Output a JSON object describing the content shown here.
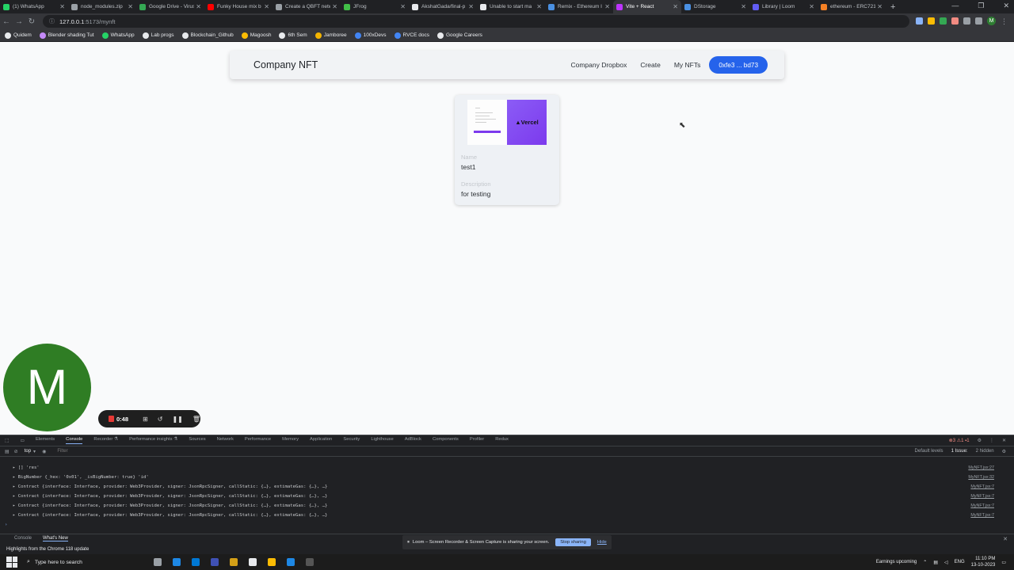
{
  "browser": {
    "tabs": [
      {
        "label": "(1) WhatsApp",
        "color": "#25d366",
        "active": false
      },
      {
        "label": "node_modules.zip",
        "color": "#9aa0a6",
        "active": false
      },
      {
        "label": "Google Drive - Virus scan",
        "color": "#34a853",
        "active": false
      },
      {
        "label": "Funky House mix b",
        "color": "#ff0000",
        "active": false
      },
      {
        "label": "Create a QBFT netw",
        "color": "#9aa0a6",
        "active": false
      },
      {
        "label": "JFrog",
        "color": "#41bf47",
        "active": false
      },
      {
        "label": "AkshatGada/final-p",
        "color": "#e8eaed",
        "active": false
      },
      {
        "label": "Unable to start ma",
        "color": "#e8eaed",
        "active": false
      },
      {
        "label": "Remix - Ethereum I",
        "color": "#4a90e2",
        "active": false
      },
      {
        "label": "Vite + React",
        "color": "#bd34fe",
        "active": true
      },
      {
        "label": "DStorage",
        "color": "#4a90e2",
        "active": false
      },
      {
        "label": "Library | Loom",
        "color": "#625df5",
        "active": false
      },
      {
        "label": "ethereum - ERC721",
        "color": "#f48024",
        "active": false
      }
    ],
    "url_host": "127.0.0.1",
    "url_rest": ":5173/mynft",
    "bookmarks": [
      {
        "label": "Quidem",
        "color": "#e8eaed"
      },
      {
        "label": "Blender shading Tut",
        "color": "#c58af9"
      },
      {
        "label": "WhatsApp",
        "color": "#25d366"
      },
      {
        "label": "Lab progs",
        "color": "#e8eaed"
      },
      {
        "label": "Blockchain_Github",
        "color": "#e8eaed"
      },
      {
        "label": "Magoosh",
        "color": "#fbbc04"
      },
      {
        "label": "6th Sem",
        "color": "#e8eaed"
      },
      {
        "label": "Jamboree",
        "color": "#f4b400"
      },
      {
        "label": "100xDevs",
        "color": "#4285f4"
      },
      {
        "label": "RVCE docs",
        "color": "#4285f4"
      },
      {
        "label": "Google Careers",
        "color": "#e8eaed"
      }
    ]
  },
  "app": {
    "brand": "Company NFT",
    "nav": {
      "dropbox": "Company Dropbox",
      "create": "Create",
      "my_nfts": "My NFTs",
      "wallet": "0xfe3 ... bd73"
    },
    "card": {
      "thumb_brand": "▲Vercel",
      "name_label": "Name",
      "name_value": "test1",
      "desc_label": "Description",
      "desc_value": "for testing"
    }
  },
  "overlay": {
    "avatar_letter": "M",
    "recorder_time": "0:48"
  },
  "devtools": {
    "tabs": [
      "Elements",
      "Console",
      "Recorder ⚗",
      "Performance insights ⚗",
      "Sources",
      "Network",
      "Performance",
      "Memory",
      "Application",
      "Security",
      "Lighthouse",
      "AdBlock",
      "Components",
      "Profiler",
      "Redux"
    ],
    "context": "top",
    "filter_placeholder": "Filter",
    "levels": "Default levels",
    "issues": "1 Issue: ",
    "hidden": "2 hidden",
    "status_counts": "⊗3 ⚠1 ▪1",
    "rows": [
      {
        "text": "▸ [] 'res'",
        "src": "MyNFT.jsx:27"
      },
      {
        "text": "▸ BigNumber {_hex: '0x01', _isBigNumber: true} 'id'",
        "src": "MyNFT.jsx:32"
      },
      {
        "text": "▸ Contract {interface: Interface, provider: Web3Provider, signer: JsonRpcSigner, callStatic: {…}, estimateGas: {…}, …}",
        "src": "MyNFT.jsx:7"
      },
      {
        "text": "▸ Contract {interface: Interface, provider: Web3Provider, signer: JsonRpcSigner, callStatic: {…}, estimateGas: {…}, …}",
        "src": "MyNFT.jsx:7"
      },
      {
        "text": "▸ Contract {interface: Interface, provider: Web3Provider, signer: JsonRpcSigner, callStatic: {…}, estimateGas: {…}, …}",
        "src": "MyNFT.jsx:7"
      },
      {
        "text": "▸ Contract {interface: Interface, provider: Web3Provider, signer: JsonRpcSigner, callStatic: {…}, estimateGas: {…}, …}",
        "src": "MyNFT.jsx:7"
      }
    ],
    "drawer_tabs": [
      "Console",
      "What's New"
    ],
    "drawer_text": "Highlights from the Chrome 118 update"
  },
  "loom_banner": {
    "text": "Loom – Screen Recorder & Screen Capture is sharing your screen.",
    "stop": "Stop sharing",
    "hide": "Hide"
  },
  "taskbar": {
    "search_placeholder": "Type here to search",
    "weather": "Earnings upcoming",
    "lang": "ENG",
    "time": "11:10 PM",
    "date": "13-10-2023"
  }
}
